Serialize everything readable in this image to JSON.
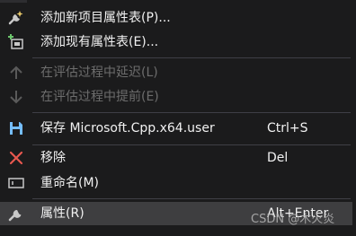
{
  "menu": {
    "items": [
      {
        "label": "添加新项目属性表(P)...",
        "icon": "add-new-property-sheet-icon"
      },
      {
        "label": "添加现有属性表(E)...",
        "icon": "add-existing-property-sheet-icon"
      },
      {
        "label": "在评估过程中延迟(L)",
        "icon": "arrow-up-icon",
        "disabled": true
      },
      {
        "label": "在评估过程中提前(E)",
        "icon": "arrow-down-icon",
        "disabled": true
      },
      {
        "label": "保存 Microsoft.Cpp.x64.user",
        "shortcut": "Ctrl+S",
        "icon": "save-icon"
      },
      {
        "label": "移除",
        "shortcut": "Del",
        "icon": "remove-x-icon"
      },
      {
        "label": "重命名(M)",
        "icon": "rename-icon"
      },
      {
        "label": "属性(R)",
        "shortcut": "Alt+Enter",
        "icon": "wrench-icon",
        "highlighted": true
      }
    ]
  },
  "watermark": "CSDN @木火炎",
  "colors": {
    "background": "#1b1b1c",
    "text": "#f1f1f1",
    "disabled_text": "#6d6d6d",
    "highlight": "#3e3e40",
    "separator": "#3f3f46",
    "save_icon": "#75beff",
    "remove_icon": "#e8584f"
  }
}
